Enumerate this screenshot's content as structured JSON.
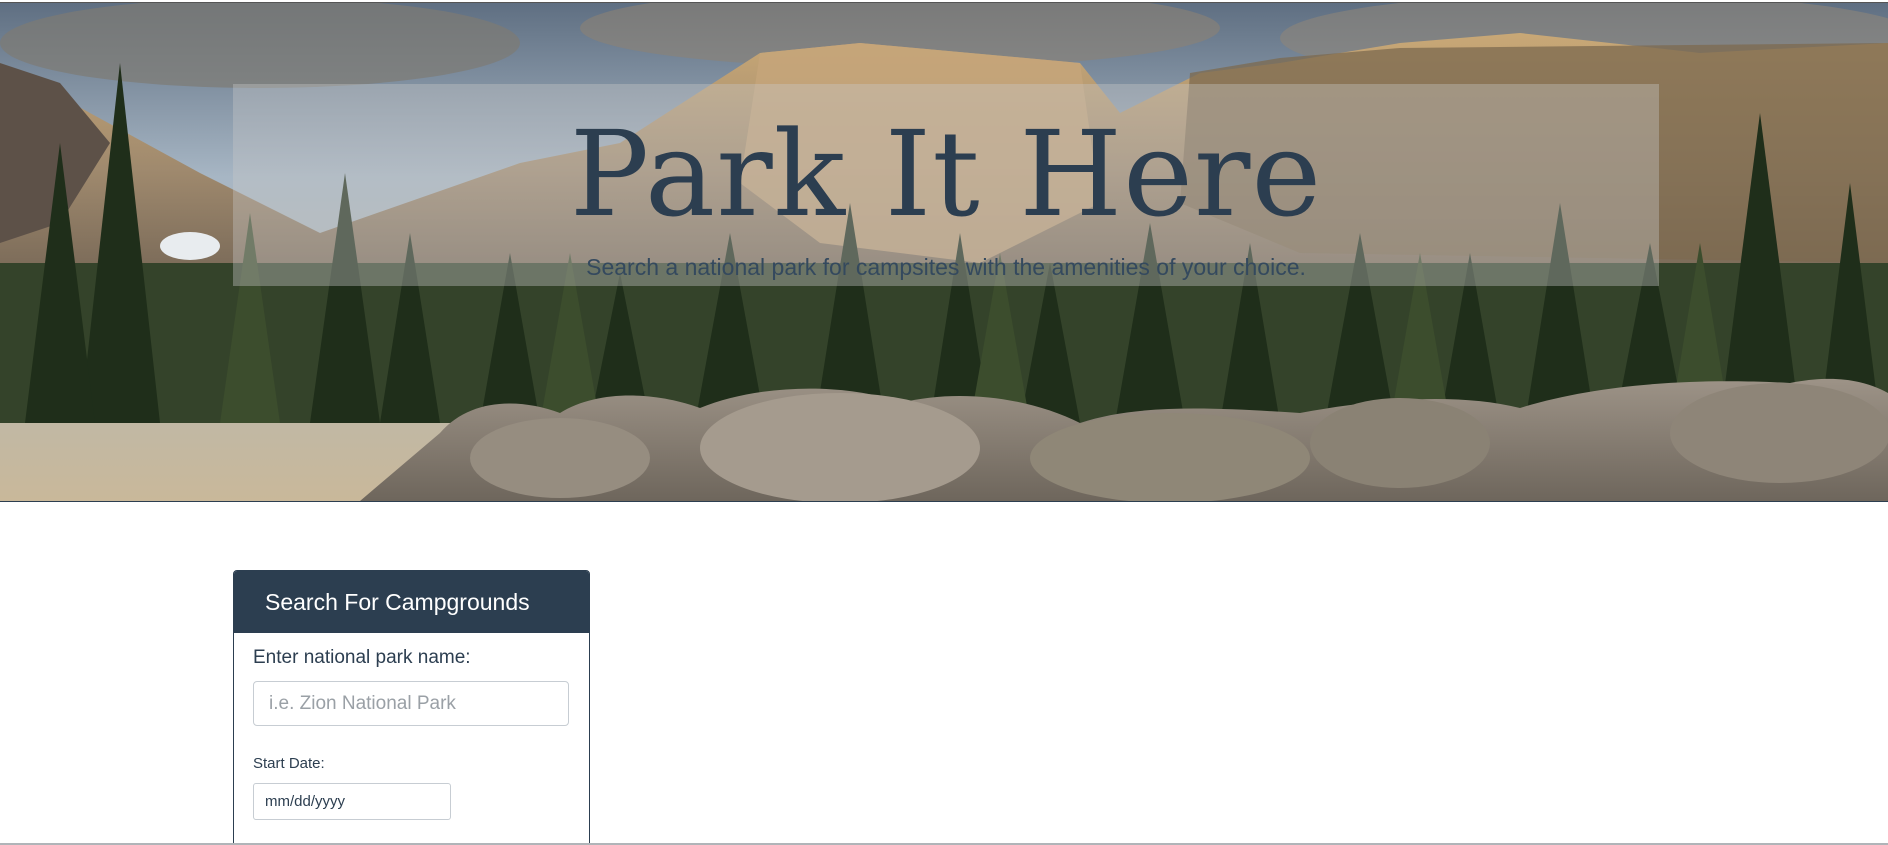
{
  "hero": {
    "title": "Park It Here",
    "subtitle": "Search a national park for campsites with the amenities of your choice."
  },
  "search_panel": {
    "header": "Search For Campgrounds",
    "park_label": "Enter national park name:",
    "park_placeholder": "i.e. Zion National Park",
    "start_date_label": "Start Date:",
    "start_date_placeholder": "mm/dd/yyyy"
  },
  "colors": {
    "primary": "#2c3e50",
    "background": "#ffffff",
    "input_border": "#c7cdd3"
  }
}
